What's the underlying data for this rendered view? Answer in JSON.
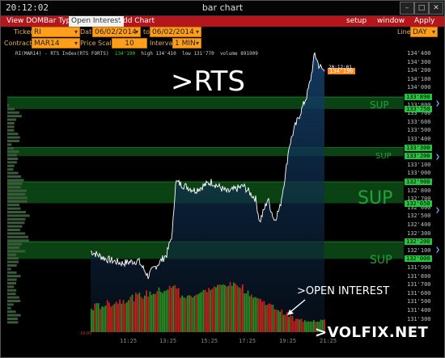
{
  "window": {
    "clock": "20:12:02",
    "title": "bar chart",
    "min_icon": "minimize-icon",
    "max_icon": "maximize-icon",
    "close_icon": "close-icon"
  },
  "menu": {
    "left": [
      "View DOM",
      "Bar Type",
      "Open Interest",
      "Add Chart"
    ],
    "active": "Open Interest",
    "right": [
      "setup",
      "window",
      "Apply"
    ]
  },
  "controls": {
    "ticker_label": "Ticker",
    "ticker_value": "RI",
    "date_label": "Date",
    "date_from": "06/02/2014",
    "to_label": "to",
    "date_to": "06/02/2014",
    "line_label": "Line",
    "line_value": "DAY",
    "contract_label": "Contract",
    "contract_value": "MAR14",
    "price_scale_label": "Price Scale",
    "price_scale_value": "10",
    "interval_label": "Interval",
    "interval_value": "1 MIN",
    "dropdown_icon": "chevron-down-icon"
  },
  "chart_info": {
    "symbol": "RI(MAR14) - RTS Index(RTS FORTS)",
    "last": "134'190",
    "high": "high 134'410",
    "low": "low 131'770",
    "volume": "volume 891909"
  },
  "overlay": {
    "title": ">RTS",
    "oi_label": ">OPEN INTEREST",
    "watermark": ">VOLFIX.NET",
    "sup_labels": [
      "SUP",
      "SUP",
      "SUP",
      "SUP"
    ]
  },
  "price_axis": {
    "ticks": [
      "134'400",
      "134'300",
      "134'200",
      "134'100",
      "134'000",
      "133'900",
      "133'800",
      "133'700",
      "133'600",
      "133'500",
      "133'400",
      "133'300",
      "133'200",
      "133'100",
      "133'000",
      "132'900",
      "132'800",
      "132'700",
      "132'600",
      "132'500",
      "132'400",
      "132'300",
      "132'200",
      "132'100",
      "132'000",
      "131'900",
      "131'800",
      "131'700",
      "131'600",
      "131'500",
      "131'400",
      "131'300"
    ],
    "marks": [
      {
        "text": "133'890",
        "price": 133890,
        "color": "green"
      },
      {
        "text": "133'750",
        "price": 133750,
        "color": "green"
      },
      {
        "text": "133'300",
        "price": 133300,
        "color": "green"
      },
      {
        "text": "133'200",
        "price": 133200,
        "color": "green"
      },
      {
        "text": "132'900",
        "price": 132900,
        "color": "green"
      },
      {
        "text": "132'650",
        "price": 132650,
        "color": "green"
      },
      {
        "text": "132'200",
        "price": 132200,
        "color": "green"
      },
      {
        "text": "132'000",
        "price": 132000,
        "color": "green"
      }
    ],
    "last_price": {
      "text": "134'190",
      "price": 134190
    },
    "last_time": "20:12:01"
  },
  "time_axis": {
    "ticks": [
      "11:25",
      "13:25",
      "15:25",
      "17:25",
      "19:25",
      "21:25"
    ],
    "start": "10:00"
  },
  "colors": {
    "background": "#000000",
    "price_line": "#ffffff",
    "menu_bar": "#b4161b",
    "field": "#ff9e1a",
    "support_zone": "#0c4d18",
    "support_label": "#1fa438",
    "oi_up": "#c3231c",
    "oi_down": "#2c8c24",
    "value_area": "#0f2d4d"
  }
}
